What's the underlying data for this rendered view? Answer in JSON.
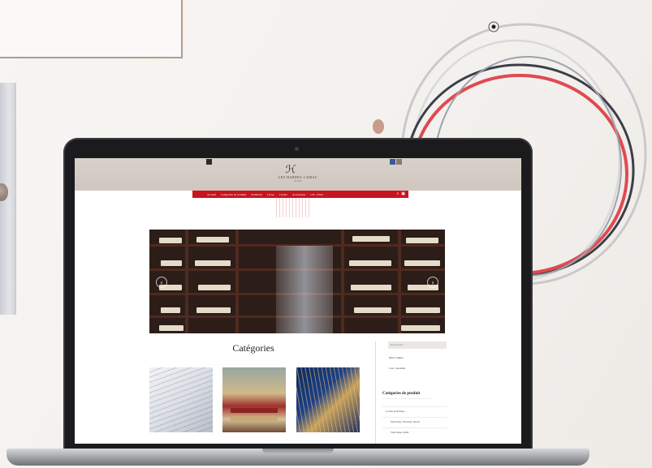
{
  "site": {
    "logo_mark": "ℋ",
    "logo_text": "LES HARPES CAMAC",
    "logo_sub": "FRANCE"
  },
  "nav": {
    "items": [
      "Accueil",
      "Catégories de produits",
      "Partitions",
      "Livres",
      "Cordes",
      "Accessoires",
      "CD - DVD"
    ],
    "search_icon": "search-icon",
    "cart_icon": "cart-icon"
  },
  "hero": {
    "prev_label": "‹",
    "next_label": "›"
  },
  "main": {
    "section_title": "Catégories"
  },
  "sidebar": {
    "search_placeholder": "Rechercher",
    "account_link": "Mon compte",
    "cart_link": "Cart  /  produits",
    "categories_heading": "Catégories de produit",
    "categories": [
      "Cordes pour harpe",
      "Fabricants, Encorder, Droits",
      "Tutti harpe Lakilt"
    ]
  },
  "colors": {
    "nav_red": "#c8141f",
    "header_beige": "#d8d1c9",
    "laptop_body": "#1b1b1d"
  }
}
